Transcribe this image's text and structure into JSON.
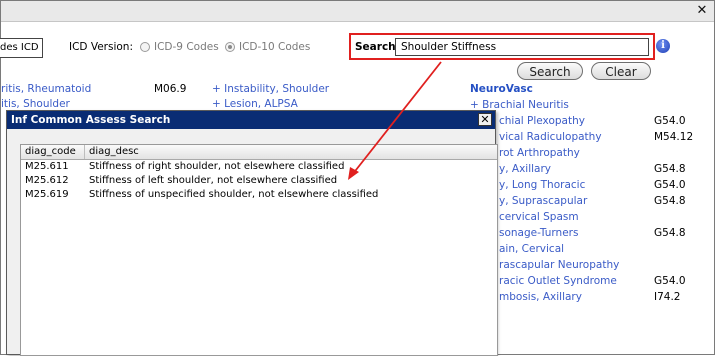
{
  "window": {
    "close_glyph": "✕"
  },
  "toolbar": {
    "codes_box_text": "des ICD",
    "icd_version_label": "ICD Version:",
    "icd9_label": "ICD-9 Codes",
    "icd10_label": "ICD-10 Codes",
    "selected_version": "ICD-10 Codes",
    "search_label": "Search:",
    "search_value": "Shoulder Stiffness",
    "search_button": "Search",
    "clear_button": "Clear",
    "info_glyph": "i"
  },
  "background": {
    "left_col": [
      {
        "text": "ritis, Rheumatoid",
        "code": "M06.9"
      },
      {
        "text": "itis, Shoulder",
        "code": ""
      }
    ],
    "middle_col": [
      {
        "text": "+ Instability, Shoulder"
      },
      {
        "text": "+ Lesion, ALPSA"
      }
    ],
    "neurovasc_heading": "NeuroVasc",
    "right_col": [
      {
        "text": "+ Brachial Neuritis",
        "code": ""
      },
      {
        "text": "chial Plexopathy",
        "code": "G54.0"
      },
      {
        "text": "vical Radiculopathy",
        "code": "M54.12"
      },
      {
        "text": "rot Arthropathy",
        "code": ""
      },
      {
        "text": "y, Axillary",
        "code": "G54.8"
      },
      {
        "text": "y, Long Thoracic",
        "code": "G54.0"
      },
      {
        "text": "y, Suprascapular",
        "code": "G54.8"
      },
      {
        "text": "cervical Spasm",
        "code": ""
      },
      {
        "text": "sonage-Turners",
        "code": "G54.8"
      },
      {
        "text": "ain, Cervical",
        "code": ""
      },
      {
        "text": "rascapular Neuropathy",
        "code": ""
      },
      {
        "text": "racic Outlet Syndrome",
        "code": "G54.0"
      },
      {
        "text": "mbosis, Axillary",
        "code": "I74.2"
      }
    ]
  },
  "dialog": {
    "title": "Inf Common Assess Search",
    "close_glyph": "✕",
    "columns": [
      "diag_code",
      "diag_desc"
    ],
    "rows": [
      {
        "code": "M25.611",
        "desc": "Stiffness of right shoulder, not elsewhere classified"
      },
      {
        "code": "M25.612",
        "desc": "Stiffness of left shoulder, not elsewhere classified"
      },
      {
        "code": "M25.619",
        "desc": "Stiffness of unspecified shoulder, not elsewhere classified"
      }
    ]
  },
  "annotation": {
    "color": "#e0201f",
    "highlight_color": "#e0201f"
  }
}
